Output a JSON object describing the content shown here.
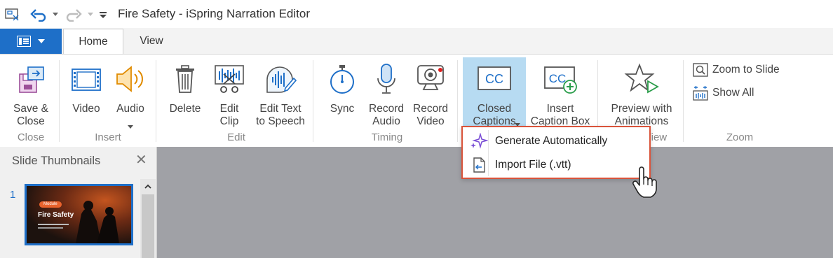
{
  "window": {
    "title": "Fire Safety - iSpring Narration Editor"
  },
  "quick_access": {
    "icons": [
      "save-icon",
      "undo-icon",
      "undo-dropdown-icon",
      "redo-icon",
      "redo-dropdown-icon",
      "customize-qat-icon"
    ]
  },
  "tabs": [
    {
      "label": "Home",
      "active": true
    },
    {
      "label": "View",
      "active": false
    }
  ],
  "ribbon": {
    "groups": {
      "close": "Close",
      "insert": "Insert",
      "edit": "Edit",
      "timing": "Timing",
      "view": "View",
      "zoom": "Zoom"
    },
    "buttons": {
      "save_close": "Save &\nClose",
      "video": "Video",
      "audio": "Audio",
      "delete": "Delete",
      "edit_clip": "Edit\nClip",
      "edit_text_to_speech": "Edit Text\nto Speech",
      "sync": "Sync",
      "record_audio": "Record\nAudio",
      "record_video": "Record\nVideo",
      "closed_captions": "Closed\nCaptions",
      "insert_caption_box": "Insert\nCaption Box",
      "preview_with_animations": "Preview with\nAnimations",
      "zoom_to_slide": "Zoom to Slide",
      "show_all": "Show All"
    }
  },
  "captions_menu": {
    "items": [
      {
        "label": "Generate Automatically",
        "icon": "sparkle-icon"
      },
      {
        "label": "Import File (.vtt)",
        "icon": "import-file-icon"
      }
    ]
  },
  "slide_panel": {
    "title": "Slide Thumbnails",
    "slides": [
      {
        "number": "1",
        "thumbnail_title": "Fire Safety",
        "thumbnail_tag": "Module"
      }
    ]
  },
  "colors": {
    "accent": "#1e6fc8",
    "active_button": "#b7dbf2",
    "menu_border": "#d9533a",
    "canvas": "#a0a1a6"
  }
}
